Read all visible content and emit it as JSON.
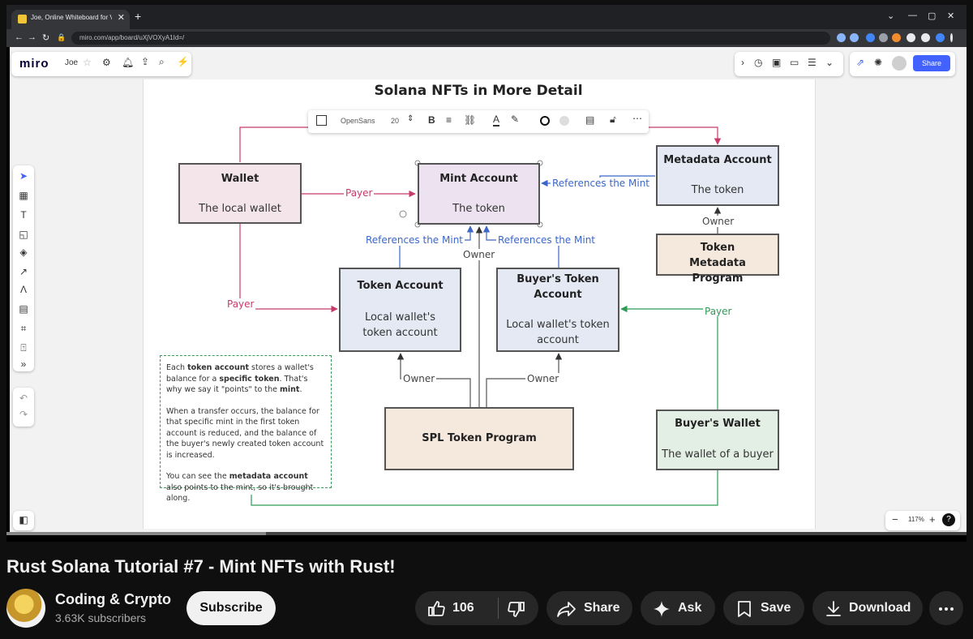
{
  "browser": {
    "tab_title": "Joe, Online Whiteboard for Visu...",
    "url": "miro.com/app/board/uXjVOXyA1Id=/"
  },
  "miro": {
    "logo": "miro",
    "board_name": "Joe",
    "zoom": "117%",
    "toolbar": {
      "font": "OpenSans",
      "font_size": "20",
      "share_label": "Share"
    }
  },
  "diagram": {
    "title": "Solana NFTs in More Detail",
    "wallet": {
      "title": "Wallet",
      "sub": "The local wallet"
    },
    "mint": {
      "title": "Mint Account",
      "sub": "The token"
    },
    "metadata": {
      "title": "Metadata Account",
      "sub": "The token"
    },
    "token_metadata_program": {
      "title": "Token Metadata Program"
    },
    "token_account": {
      "title": "Token Account",
      "sub": "Local wallet's token account"
    },
    "buyers_token_account": {
      "title": "Buyer's Token Account",
      "sub": "Local wallet's token account"
    },
    "spl": {
      "title": "SPL Token Program"
    },
    "buyers_wallet": {
      "title": "Buyer's Wallet",
      "sub": "The wallet of a buyer"
    },
    "labels": {
      "payer": "Payer",
      "references_mint": "References the Mint",
      "owner": "Owner"
    },
    "note": {
      "p1_a": "Each ",
      "p1_b": "token account",
      "p1_c": " stores a wallet's balance for a ",
      "p1_d": "specific token",
      "p1_e": ". That's why we say it \"points\" to the ",
      "p1_f": "mint",
      "p1_g": ".",
      "p2": "When a transfer occurs, the balance for that specific mint in the first token account is reduced, and the balance of the buyer's newly created token account is increased.",
      "p3_a": "You can see the ",
      "p3_b": "metadata account",
      "p3_c": " also points to the mint, so it's brought along."
    }
  },
  "video": {
    "progress_fraction": 0.27,
    "title": "Rust Solana Tutorial #7 - Mint NFTs with Rust!",
    "channel": "Coding & Crypto",
    "subscribers": "3.63K subscribers",
    "subscribe_label": "Subscribe",
    "likes": "106",
    "share_label": "Share",
    "ask_label": "Ask",
    "save_label": "Save",
    "download_label": "Download"
  },
  "colors": {
    "payer": "#c73b6c",
    "references": "#3a67c8",
    "buyer_payer": "#2f9a54",
    "accent": "#4262ff"
  }
}
